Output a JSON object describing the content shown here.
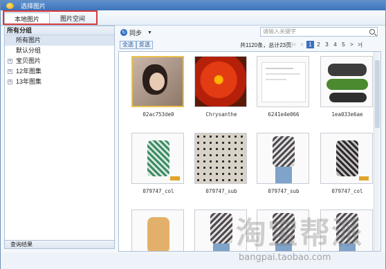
{
  "window": {
    "title": "选择图片"
  },
  "tabs": [
    {
      "label": "本地图片"
    },
    {
      "label": "图片空间"
    }
  ],
  "sidebar": {
    "header": "所有分组",
    "items": [
      {
        "label": "所有图片",
        "active": true,
        "expandable": false
      },
      {
        "label": "默认分组",
        "active": false,
        "expandable": false
      },
      {
        "label": "宝贝图片",
        "active": false,
        "expandable": true
      },
      {
        "label": "12年图集",
        "active": false,
        "expandable": true
      },
      {
        "label": "13年图集",
        "active": false,
        "expandable": true
      }
    ],
    "footer": "查询结果"
  },
  "toolbar": {
    "sync_label": "同步",
    "search_placeholder": "请输入关键字",
    "select_all": "全选",
    "invert": "反选",
    "count_text": "共1120条，总计23页",
    "pager": [
      "|<",
      "<",
      "1",
      "2",
      "3",
      "4",
      "5",
      ">",
      ">|"
    ],
    "current_page": "1"
  },
  "images": [
    {
      "caption": "02ac753de0",
      "subject": "portrait-photo",
      "selected": true
    },
    {
      "caption": "Chrysanthe",
      "subject": "red-flower-photo",
      "selected": false
    },
    {
      "caption": "6241e4e066",
      "subject": "document-screenshot",
      "selected": false
    },
    {
      "caption": "1ea033e6ae",
      "subject": "sneakers-photo",
      "selected": false
    },
    {
      "caption": "079747_col",
      "subject": "green-floral-jacket",
      "selected": false
    },
    {
      "caption": "079747_sub",
      "subject": "leopard-jacket-detail",
      "selected": false
    },
    {
      "caption": "079747_sub",
      "subject": "model-floral-jacket",
      "selected": false
    },
    {
      "caption": "079747_col",
      "subject": "dark-floral-jacket",
      "selected": false
    },
    {
      "caption": "",
      "subject": "orange-hoodie",
      "selected": false
    },
    {
      "caption": "",
      "subject": "model-floral-jacket",
      "selected": false
    },
    {
      "caption": "",
      "subject": "model-floral-jacket",
      "selected": false
    },
    {
      "caption": "",
      "subject": "model-floral-jacket",
      "selected": false
    }
  ],
  "watermark": {
    "text": "淘宝帮派",
    "url": "bangpai.taobao.com"
  },
  "colors": {
    "accent": "#3a70c0",
    "highlight": "#d43a3a",
    "selection": "#e8c14a"
  }
}
